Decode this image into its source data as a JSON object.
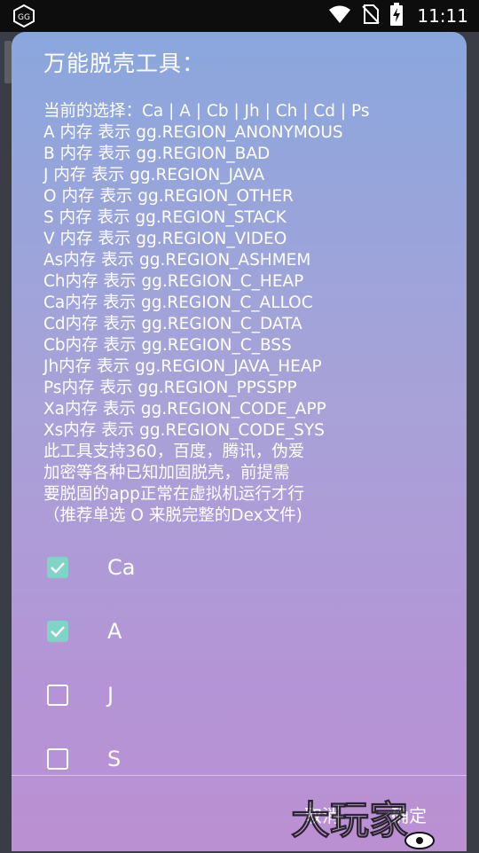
{
  "status_bar": {
    "time": "11:11",
    "icons": [
      "gg-app-icon",
      "wifi-icon",
      "no-sim-icon",
      "battery-charging-icon"
    ]
  },
  "dialog": {
    "title": "万能脱壳工具：",
    "message_lines": [
      "当前的选择：Ca | A | Cb | Jh | Ch | Cd | Ps",
      "A 内存 表示 gg.REGION_ANONYMOUS",
      "B 内存 表示 gg.REGION_BAD",
      "J 内存 表示 gg.REGION_JAVA",
      "O 内存 表示 gg.REGION_OTHER",
      "S 内存 表示 gg.REGION_STACK",
      "V 内存 表示 gg.REGION_VIDEO",
      "As内存 表示 gg.REGION_ASHMEM",
      "Ch内存 表示 gg.REGION_C_HEAP",
      "Ca内存 表示 gg.REGION_C_ALLOC",
      "Cd内存 表示 gg.REGION_C_DATA",
      "Cb内存 表示 gg.REGION_C_BSS",
      "Jh内存 表示 gg.REGION_JAVA_HEAP",
      "Ps内存 表示 gg.REGION_PPSSPP",
      "Xa内存 表示 gg.REGION_CODE_APP",
      "Xs内存 表示 gg.REGION_CODE_SYS",
      "此工具支持360，百度，腾讯，伪爱",
      "加密等各种已知加固脱壳，前提需",
      "要脱固的app正常在虚拟机运行才行",
      "（推荐单选 O 来脱完整的Dex文件)"
    ],
    "options": [
      {
        "label": "Ca",
        "checked": true
      },
      {
        "label": "A",
        "checked": true
      },
      {
        "label": "J",
        "checked": false
      },
      {
        "label": "S",
        "checked": false
      }
    ],
    "cancel_label": "取消",
    "ok_label": "确定"
  },
  "watermark": {
    "text": "大玩家"
  },
  "colors": {
    "check_accent": "#7fd3c7",
    "gradient_top": "#8aa7dd",
    "gradient_bottom": "#bb90d2"
  }
}
